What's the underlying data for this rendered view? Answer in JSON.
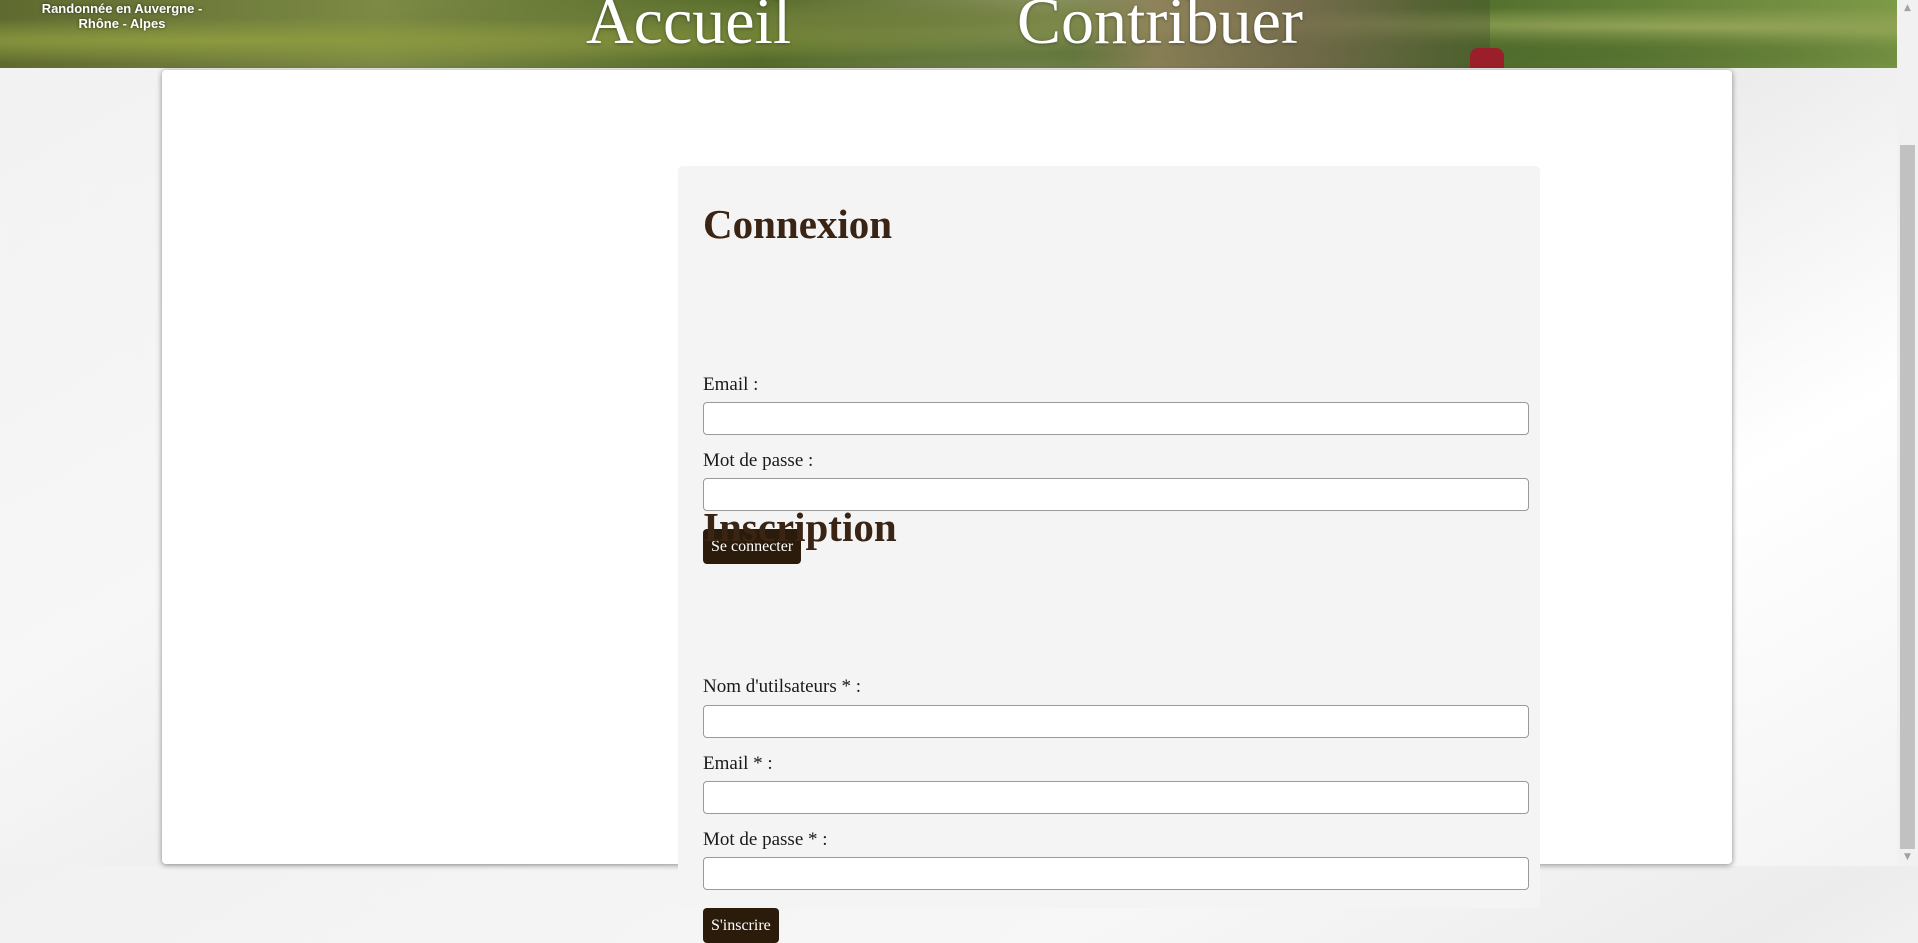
{
  "header": {
    "logo": {
      "line1": "Randonnée en Auvergne -",
      "line2": "Rhône - Alpes"
    },
    "nav": [
      {
        "label": "Accueil"
      },
      {
        "label": "Contribuer"
      }
    ]
  },
  "login": {
    "title": "Connexion",
    "email_label": "Email :",
    "email_value": "",
    "password_label": "Mot de passe :",
    "password_value": "",
    "submit_label": "Se connecter"
  },
  "register": {
    "title": "Inscription",
    "username_label": "Nom d'utilsateurs * :",
    "username_value": "",
    "email_label": "Email * :",
    "email_value": "",
    "password_label": "Mot de passe * :",
    "password_value": "",
    "submit_label": "S'inscrire"
  },
  "scrollbar": {
    "up_icon": "chevron-up-icon",
    "down_icon": "chevron-down-icon"
  },
  "colors": {
    "heading": "#3a2413",
    "button_bg": "#2a1b0b",
    "panel_bg": "#f4f4f4"
  }
}
